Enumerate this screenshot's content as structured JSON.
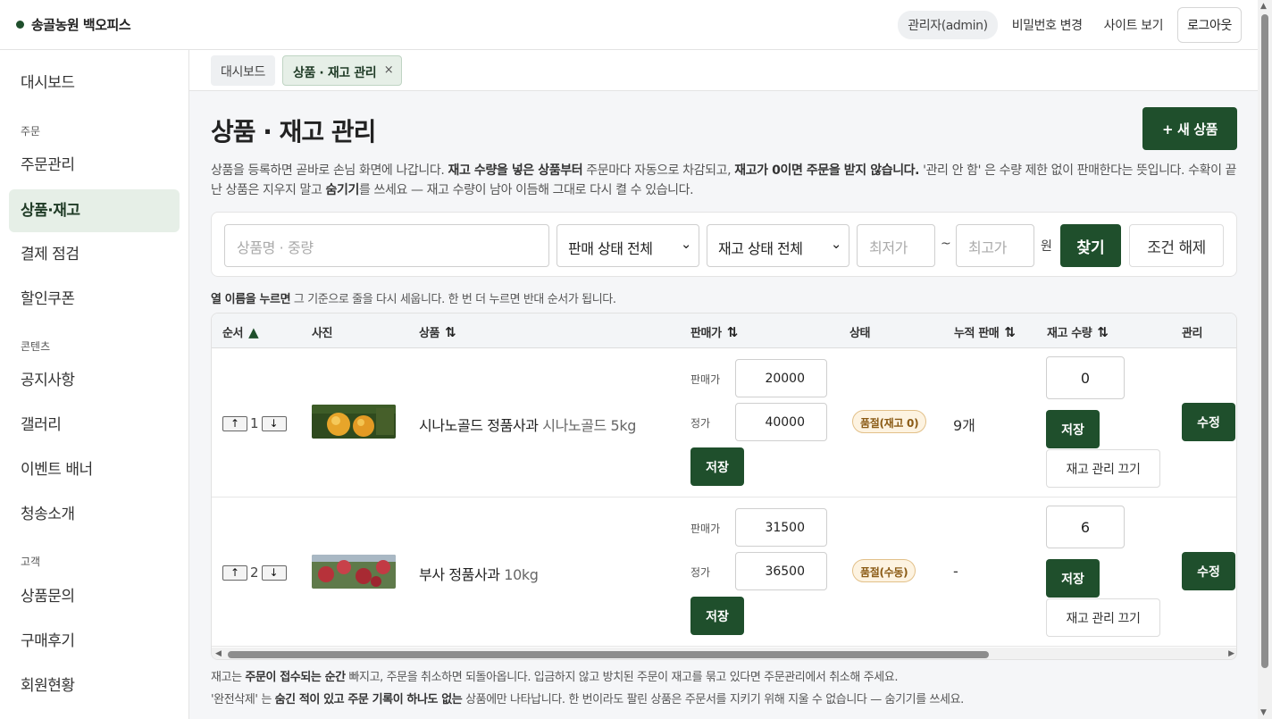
{
  "topbar": {
    "brand": "송골농원 백오피스",
    "admin_label": "관리자(admin)",
    "change_password": "비밀번호 변경",
    "view_site": "사이트 보기",
    "logout": "로그아웃"
  },
  "sidebar": {
    "dashboard": "대시보드",
    "group_order": "주문",
    "orders": "주문관리",
    "products": "상품·재고",
    "payments": "결제 점검",
    "coupons": "할인쿠폰",
    "group_content": "콘텐츠",
    "notices": "공지사항",
    "gallery": "갤러리",
    "banners": "이벤트 배너",
    "intro": "청송소개",
    "group_customer": "고객",
    "inquiries": "상품문의",
    "reviews": "구매후기",
    "members": "회원현황"
  },
  "tabs": {
    "dashboard": "대시보드",
    "current": "상품 · 재고 관리",
    "close": "×"
  },
  "page": {
    "title": "상품 · 재고 관리",
    "new_button": "+ 새 상품",
    "desc_1": "상품을 등록하면 곧바로 손님 화면에 나갑니다. ",
    "desc_b1": "재고 수량을 넣은 상품부터",
    "desc_2": " 주문마다 자동으로 차감되고, ",
    "desc_b2": "재고가 0이면 주문을 받지 않습니다.",
    "desc_3": " '관리 안 함' 은 수량 제한 없이 판매한다는 뜻입니다. 수확이 끝난 상품은 지우지 말고 ",
    "desc_b3": "숨기기",
    "desc_4": "를 쓰세요 — 재고 수량이 남아 이듬해 그대로 다시 켤 수 있습니다."
  },
  "filter": {
    "search_placeholder": "상품명 · 중량",
    "sale_status": "판매 상태 전체",
    "stock_status": "재고 상태 전체",
    "min_placeholder": "최저가",
    "tilde": "~",
    "max_placeholder": "최고가",
    "won": "원",
    "find": "찾기",
    "clear": "조건 해제"
  },
  "hint": {
    "bold": "열 이름을 누르면",
    "rest": " 그 기준으로 줄을 다시 세웁니다. 한 번 더 누르면 반대 순서가 됩니다."
  },
  "table": {
    "headers": {
      "order": "순서",
      "order_sort": "▲",
      "photo": "사진",
      "product": "상품",
      "price": "판매가",
      "status": "상태",
      "cumulative": "누적 판매",
      "stock": "재고 수량",
      "manage": "관리",
      "sort_icon": "⇅"
    },
    "labels": {
      "sale_price": "판매가",
      "list_price": "정가",
      "save": "저장",
      "stock_off": "재고 관리 끄기",
      "edit": "수정",
      "up": "↑",
      "down": "↓"
    },
    "rows": [
      {
        "order": "1",
        "name": "시나노골드 정품사과",
        "sub": "시나노골드 5kg",
        "sale_price": "20000",
        "list_price": "40000",
        "status": "품절(재고 0)",
        "cumulative": "9개",
        "stock": "0"
      },
      {
        "order": "2",
        "name": "부사 정품사과",
        "sub": "10kg",
        "sale_price": "31500",
        "list_price": "36500",
        "status": "품절(수동)",
        "cumulative": "-",
        "stock": "6"
      }
    ]
  },
  "footer": {
    "line1_a": "재고는 ",
    "line1_b": "주문이 접수되는 순간",
    "line1_c": " 빠지고, 주문을 취소하면 되돌아옵니다. 입금하지 않고 방치된 주문이 재고를 묶고 있다면 주문관리에서 취소해 주세요.",
    "line2_a": "'완전삭제' 는 ",
    "line2_b": "숨긴 적이 있고 주문 기록이 하나도 없는",
    "line2_c": " 상품에만 나타납니다. 한 번이라도 팔린 상품은 주문서를 지키기 위해 지울 수 없습니다 — 숨기기를 쓰세요."
  },
  "colors": {
    "brand_green": "#1f4f2c",
    "active_nav_bg": "#e6efe7",
    "badge_bg": "#fdf3e1"
  }
}
